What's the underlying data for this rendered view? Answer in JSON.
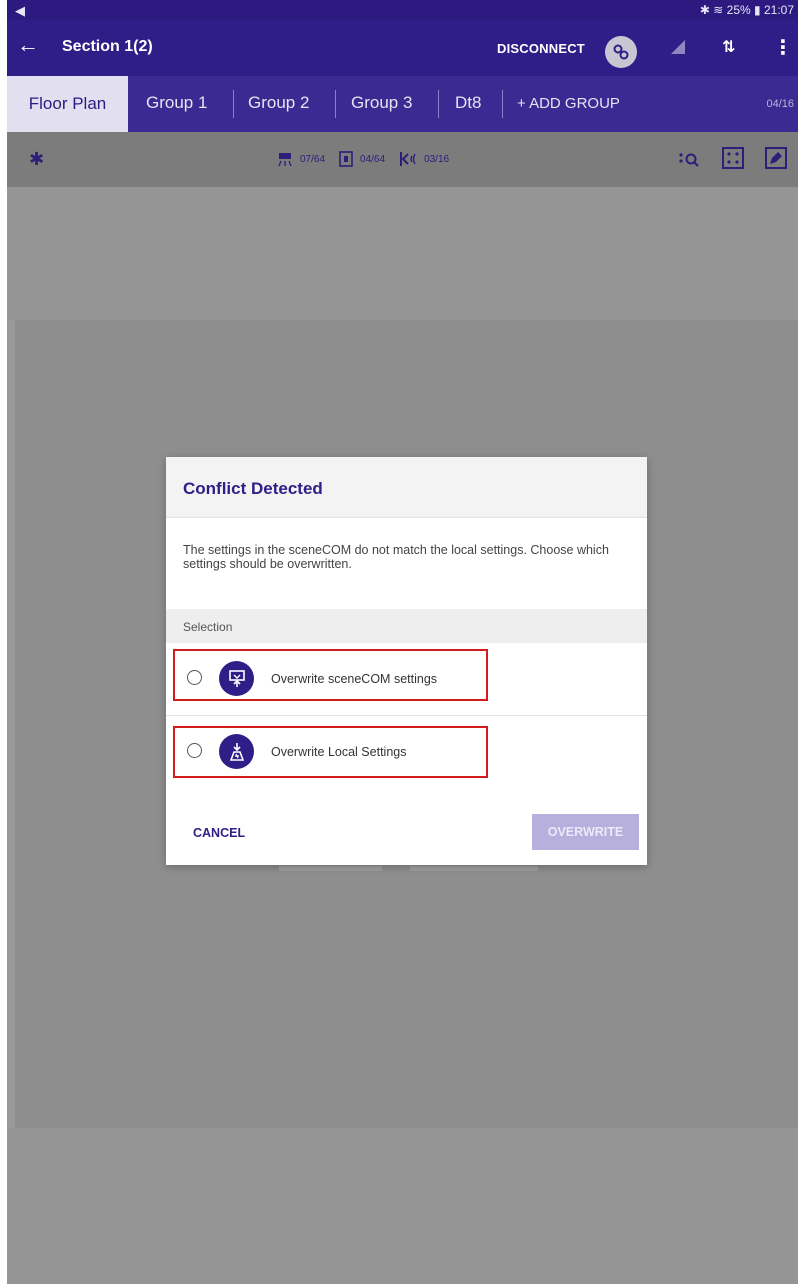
{
  "status_bar": {
    "back_glyph": "◀",
    "icons": "✱ ≋",
    "battery": "25%",
    "time": "21:07"
  },
  "app_bar": {
    "title": "Section 1(2)",
    "disconnect_label": "DISCONNECT",
    "icons": [
      "back-arrow-icon",
      "link-icon",
      "signal-icon",
      "transfer-icon",
      "more-vert-icon"
    ]
  },
  "tabs": {
    "items": [
      "Floor Plan",
      "Group 1",
      "Group 2",
      "Group 3",
      "Dt8"
    ],
    "add_group_label": "+ ADD GROUP",
    "count": "04/16"
  },
  "toolbar": {
    "luminaire_count": "07/64",
    "switch_count": "04/64",
    "sensor_count": "03/16"
  },
  "dialog": {
    "title": "Conflict Detected",
    "message": "The settings in the sceneCOM do not match the local settings. Choose which settings should be overwritten.",
    "selection_header": "Selection",
    "options": [
      {
        "label": "Overwrite sceneCOM settings",
        "icon": "device-upload-icon"
      },
      {
        "label": "Overwrite Local Settings",
        "icon": "local-download-icon"
      }
    ],
    "cancel_label": "CANCEL",
    "overwrite_label": "OVERWRITE"
  },
  "colors": {
    "primary": "#2f1e87",
    "highlight": "#d51c1c",
    "disabled_button": "#b7afdc"
  }
}
